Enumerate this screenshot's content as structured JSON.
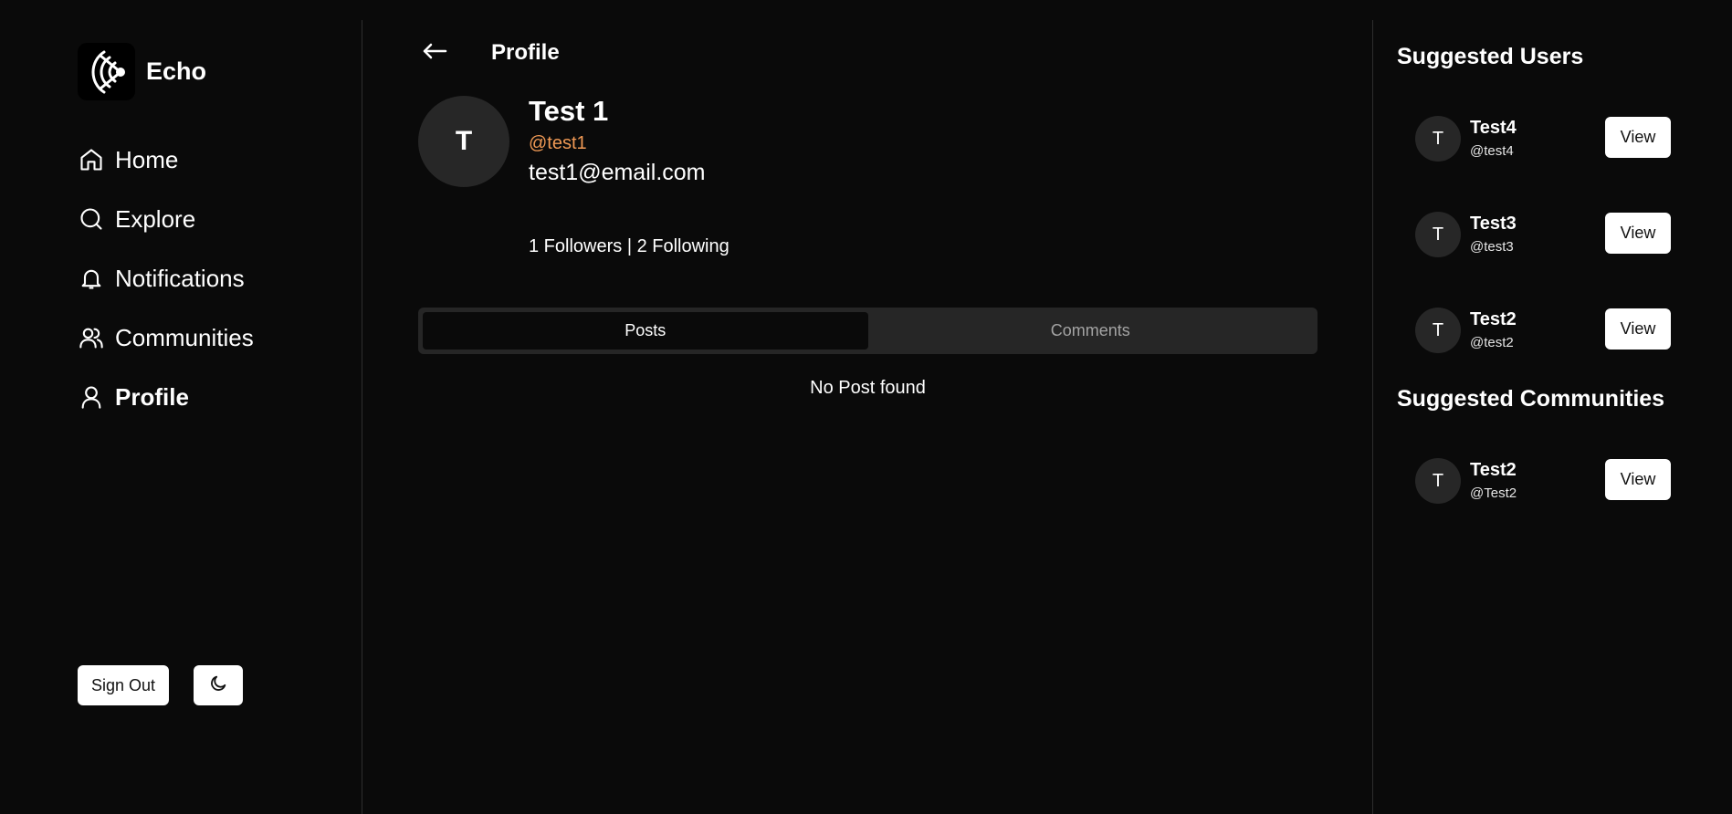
{
  "app": {
    "name": "Echo"
  },
  "sidebar": {
    "items": [
      {
        "label": "Home",
        "icon": "home-icon"
      },
      {
        "label": "Explore",
        "icon": "search-icon"
      },
      {
        "label": "Notifications",
        "icon": "bell-icon"
      },
      {
        "label": "Communities",
        "icon": "users-icon"
      },
      {
        "label": "Profile",
        "icon": "user-icon",
        "active": true
      }
    ],
    "sign_out_label": "Sign Out",
    "theme_icon": "moon-icon"
  },
  "header": {
    "title": "Profile",
    "back_icon": "arrow-left-icon"
  },
  "profile": {
    "avatar_initial": "T",
    "name": "Test 1",
    "handle": "@test1",
    "email": "test1@email.com",
    "stats": "1 Followers | 2 Following"
  },
  "tabs": [
    {
      "label": "Posts",
      "active": true
    },
    {
      "label": "Comments",
      "active": false
    }
  ],
  "empty_message": "No Post found",
  "suggested_users": {
    "title": "Suggested Users",
    "items": [
      {
        "initial": "T",
        "name": "Test4",
        "handle": "@test4",
        "action": "View"
      },
      {
        "initial": "T",
        "name": "Test3",
        "handle": "@test3",
        "action": "View"
      },
      {
        "initial": "T",
        "name": "Test2",
        "handle": "@test2",
        "action": "View"
      }
    ]
  },
  "suggested_communities": {
    "title": "Suggested Communities",
    "items": [
      {
        "initial": "T",
        "name": "Test2",
        "handle": "@Test2",
        "action": "View"
      }
    ]
  },
  "colors": {
    "background": "#0a0a0a",
    "accent_handle": "#f19a55",
    "muted_surface": "#262626"
  }
}
